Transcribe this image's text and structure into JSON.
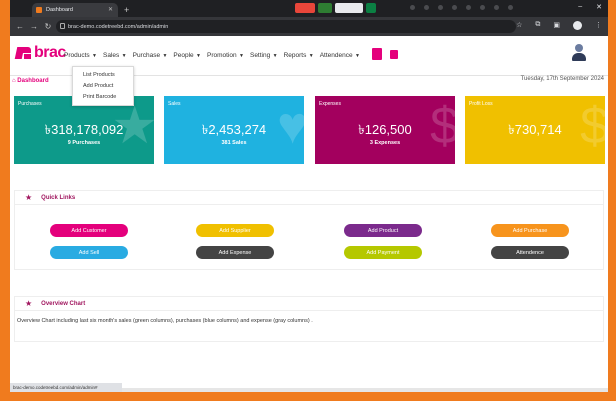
{
  "browser": {
    "tab_title": "Dashboard",
    "url": "brac-demo.codetreebd.com/admin/admin",
    "status_url": "brac-demo.codetreebd.com/admin/admin#"
  },
  "brand": {
    "name": "brac",
    "color": "#e4007c"
  },
  "menu": [
    {
      "label": "Products"
    },
    {
      "label": "Sales"
    },
    {
      "label": "Purchase"
    },
    {
      "label": "People"
    },
    {
      "label": "Promotion"
    },
    {
      "label": "Setting"
    },
    {
      "label": "Reports"
    },
    {
      "label": "Attendence"
    }
  ],
  "products_dropdown": [
    "List Products",
    "Add Product",
    "Print Barcode"
  ],
  "breadcrumb": "Dashboard",
  "date": "Tuesday, 17th September 2024",
  "cards": [
    {
      "label": "Purchases",
      "value": "৳318,178,092",
      "sub": "9 Purchases",
      "color": "#0d9a8a",
      "icon": "star-icon"
    },
    {
      "label": "Sales",
      "value": "৳2,453,274",
      "sub": "381 Sales",
      "color": "#1fb2e0",
      "icon": "heart-icon"
    },
    {
      "label": "Expenses",
      "value": "৳126,500",
      "sub": "3 Expenses",
      "color": "#a3005e",
      "icon": "dollar-icon"
    },
    {
      "label": "Profit Loss",
      "value": "৳730,714",
      "sub": "",
      "color": "#f0c000",
      "icon": "dollar-icon"
    }
  ],
  "quick_links": {
    "title": "Quick Links",
    "buttons": [
      {
        "label": "Add Customer",
        "color": "#e4007c"
      },
      {
        "label": "Add Supplier",
        "color": "#f0c000"
      },
      {
        "label": "Add Product",
        "color": "#7b2a8c"
      },
      {
        "label": "Add Purchase",
        "color": "#f7941d"
      },
      {
        "label": "Add Sell",
        "color": "#29abe2"
      },
      {
        "label": "Add Expense",
        "color": "#444444"
      },
      {
        "label": "Add Payment",
        "color": "#b5c800"
      },
      {
        "label": "Attendence",
        "color": "#444444"
      }
    ]
  },
  "overview": {
    "title": "Overview Chart",
    "description": "Overview Chart including last six month's sales (green columns), purchases (blue columns) and expense (gray columns) ."
  }
}
